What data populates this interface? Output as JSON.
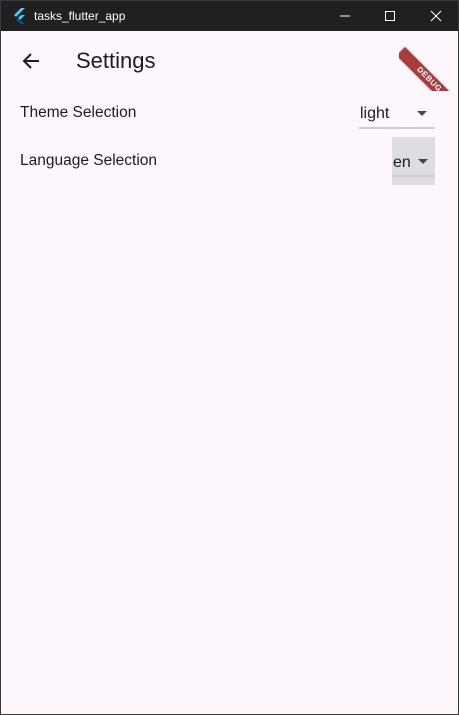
{
  "window": {
    "title": "tasks_flutter_app",
    "minimize_icon": "minimize-icon",
    "maximize_icon": "maximize-icon",
    "close_icon": "close-icon"
  },
  "appbar": {
    "back_icon": "arrow-back-icon",
    "title": "Settings",
    "debug_banner": "DEBUG"
  },
  "settings": {
    "theme": {
      "label": "Theme Selection",
      "value": "light"
    },
    "language": {
      "label": "Language Selection",
      "value": "en"
    }
  },
  "colors": {
    "background": "#fdf7fd",
    "titlebar": "#202020",
    "text": "#1d1b20",
    "debug_banner": "#a83b3b",
    "focused_dropdown": "#e0dde2"
  }
}
